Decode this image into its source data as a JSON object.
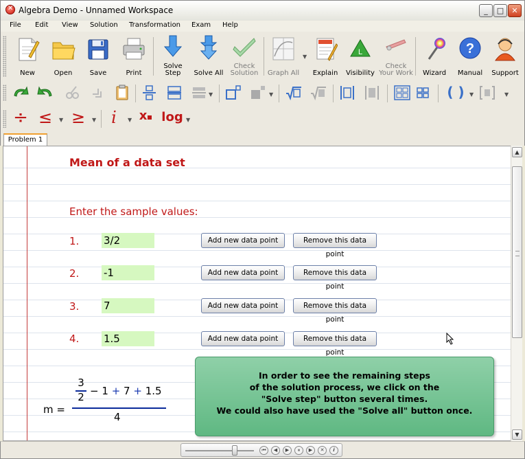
{
  "window": {
    "title": "Algebra Demo - Unnamed Workspace",
    "min": "_",
    "max": "□",
    "close": "✕"
  },
  "menu": [
    "File",
    "Edit",
    "View",
    "Solution",
    "Transformation",
    "Exam",
    "Help"
  ],
  "toolbar": {
    "new": "New",
    "open": "Open",
    "save": "Save",
    "print": "Print",
    "solve_step_1": "Solve",
    "solve_step_2": "Step",
    "solve_all": "Solve All",
    "check_solution_1": "Check",
    "check_solution_2": "Solution",
    "graph_all": "Graph All",
    "explain": "Explain",
    "visibility": "Visibility",
    "check_work_1": "Check",
    "check_work_2": "Your Work",
    "wizard": "Wizard",
    "manual": "Manual",
    "support": "Support",
    "visibility_badge": "L",
    "manual_badge": "?",
    "row2_paren": "( )",
    "row3_div": "÷",
    "row3_le": "≤",
    "row3_ge": "≥",
    "row3_i": "i",
    "row3_xsub": "x",
    "row3_log": "log"
  },
  "tabs": [
    {
      "label": "Problem 1"
    }
  ],
  "content": {
    "heading": "Mean of a data set",
    "prompt": "Enter the sample values:",
    "add_label": "Add new data point",
    "remove_label": "Remove this data point",
    "rows": [
      {
        "num": "1.",
        "value": "3/2"
      },
      {
        "num": "2.",
        "value": "-1"
      },
      {
        "num": "3.",
        "value": "7"
      },
      {
        "num": "4.",
        "value": "1.5"
      }
    ],
    "formula": {
      "lhs": "m =",
      "frac_num": "3",
      "frac_den": "2",
      "minus": "−",
      "t1": "1",
      "plus1": "+",
      "t2": "7",
      "plus2": "+",
      "t3": "1.5",
      "denominator": "4"
    },
    "info": [
      "In order to see the remaining steps",
      "of the solution process, we click on the",
      "\"Solve step\" button several times.",
      "We could also have used the \"Solve all\" button once."
    ]
  },
  "scrollbar": {
    "up": "▲",
    "down": "▼"
  },
  "player": {
    "first": "⏮",
    "prev": "◀",
    "play": "▶",
    "pause": "⏸",
    "next": "▶",
    "stop": "✕",
    "info": "i"
  }
}
